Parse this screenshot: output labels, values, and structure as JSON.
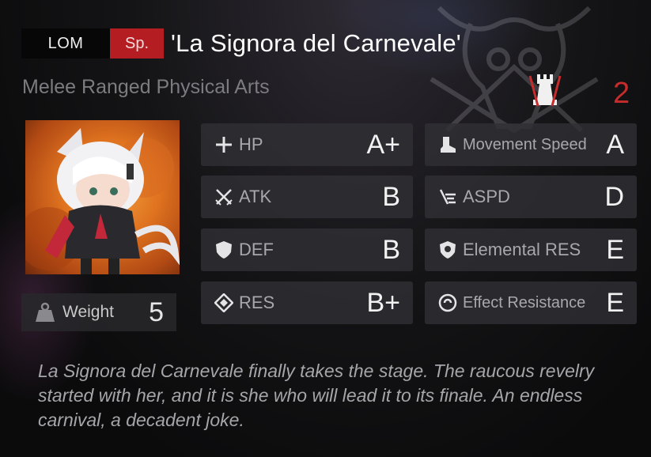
{
  "header": {
    "faction_tag": "LOM",
    "type_tag": "Sp.",
    "name": "'La Signora del Carnevale'"
  },
  "traits": "Melee Ranged Physical Arts",
  "level": "2",
  "weight": {
    "label": "Weight",
    "value": "5"
  },
  "stats_left": [
    {
      "label": "HP",
      "grade": "A+",
      "icon": "plus-icon"
    },
    {
      "label": "ATK",
      "grade": "B",
      "icon": "crossed-swords-icon"
    },
    {
      "label": "DEF",
      "grade": "B",
      "icon": "shield-icon"
    },
    {
      "label": "RES",
      "grade": "B+",
      "icon": "diamond-icon"
    }
  ],
  "stats_right": [
    {
      "label": "Movement Speed",
      "grade": "A",
      "icon": "boot-icon"
    },
    {
      "label": "ASPD",
      "grade": "D",
      "icon": "speed-lines-icon"
    },
    {
      "label": "Elemental RES",
      "grade": "E",
      "icon": "elemental-shield-icon"
    },
    {
      "label": "Effect Resistance",
      "grade": "E",
      "icon": "effect-ring-icon"
    }
  ],
  "description": "La Signora del Carnevale finally takes the stage. The raucous revelry started with her, and it is she who will lead it to its finale. An endless carnival, a decadent joke.",
  "colors": {
    "accent_red": "#b41e22",
    "level_red": "#c62c2c",
    "panel": "#303034"
  }
}
